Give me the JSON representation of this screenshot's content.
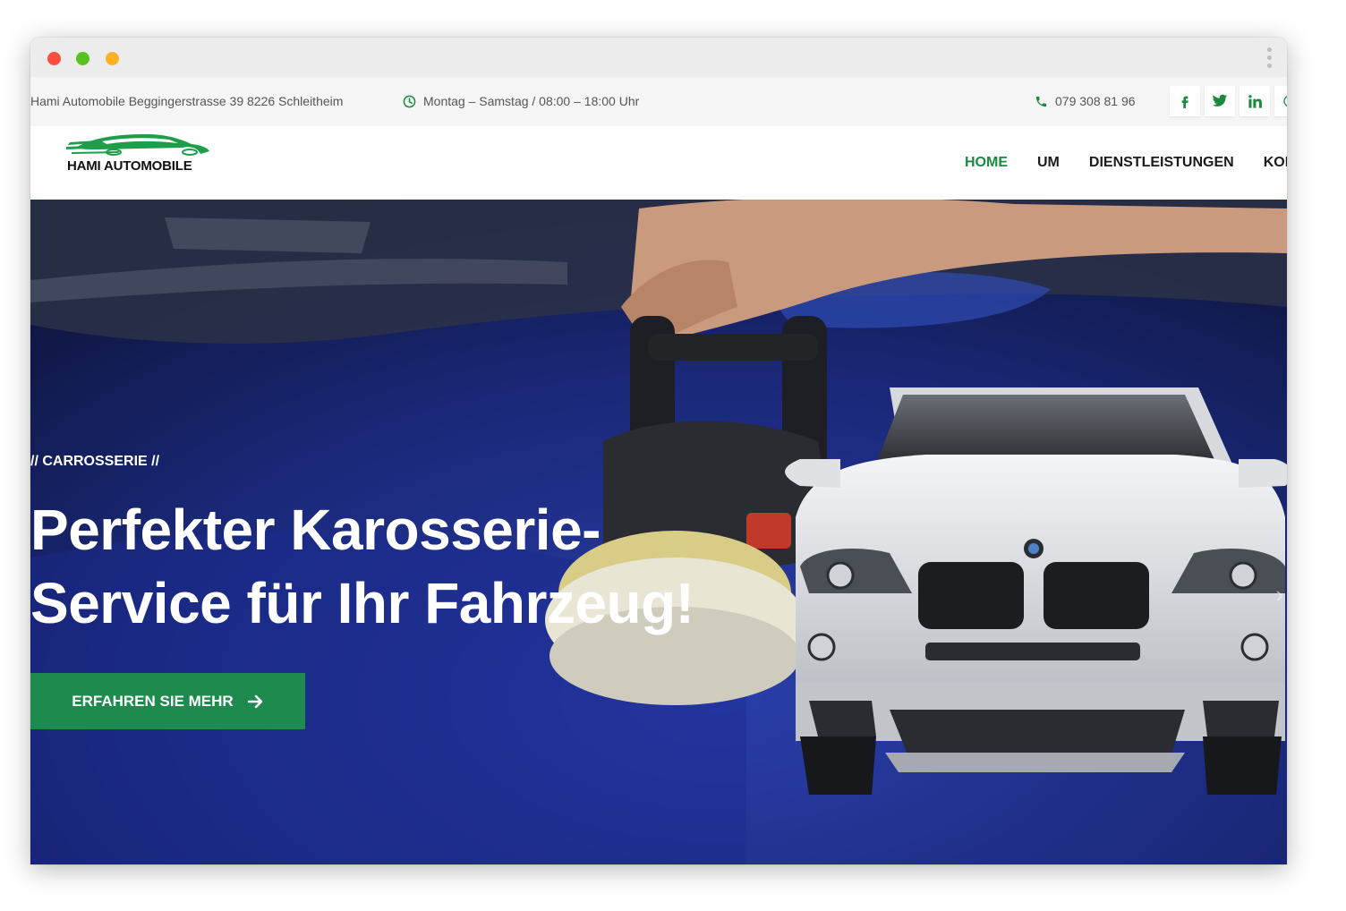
{
  "topbar": {
    "address": "Hami Automobile Beggingerstrasse 39 8226 Schleitheim",
    "hours": "Montag – Samstag / 08:00 – 18:00 Uhr",
    "phone": "079 308 81 96",
    "social": [
      {
        "icon": "facebook-icon",
        "glyph": "f"
      },
      {
        "icon": "twitter-icon",
        "glyph": "t"
      },
      {
        "icon": "linkedin-icon",
        "glyph": "in"
      }
    ]
  },
  "brand": {
    "name": "HAMI AUTOMOBILE",
    "accent_color": "#1a8a3f"
  },
  "nav": {
    "items": [
      {
        "label": "HOME",
        "active": true
      },
      {
        "label": "UM",
        "active": false
      },
      {
        "label": "DIENSTLEISTUNGEN",
        "active": false
      },
      {
        "label": "KON",
        "active": false
      }
    ]
  },
  "hero": {
    "eyebrow": "// CARROSSERIE //",
    "headline_line1": "Perfekter Karosserie-",
    "headline_line2": "Service für Ihr Fahrzeug!",
    "cta_label": "ERFAHREN SIE MEHR",
    "cta_color": "#1e8a4e",
    "prev_glyph": "‹",
    "next_glyph": "›"
  }
}
